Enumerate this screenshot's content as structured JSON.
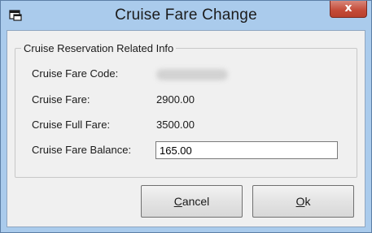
{
  "window": {
    "title": "Cruise Fare Change",
    "close_label": "x"
  },
  "group": {
    "legend": "Cruise Reservation Related Info"
  },
  "fields": {
    "fare_code_label": "Cruise Fare Code:",
    "fare_label": "Cruise Fare:",
    "fare_value": "2900.00",
    "full_fare_label": "Cruise Full Fare:",
    "full_fare_value": "3500.00",
    "balance_label": "Cruise Fare Balance:",
    "balance_value": "165.00"
  },
  "buttons": {
    "cancel_mnemonic": "C",
    "cancel_rest": "ancel",
    "ok_mnemonic": "O",
    "ok_rest": "k"
  },
  "colors": {
    "titlebar": "#aacbec",
    "close_button": "#c44a37",
    "client_bg": "#f0f0f0"
  }
}
